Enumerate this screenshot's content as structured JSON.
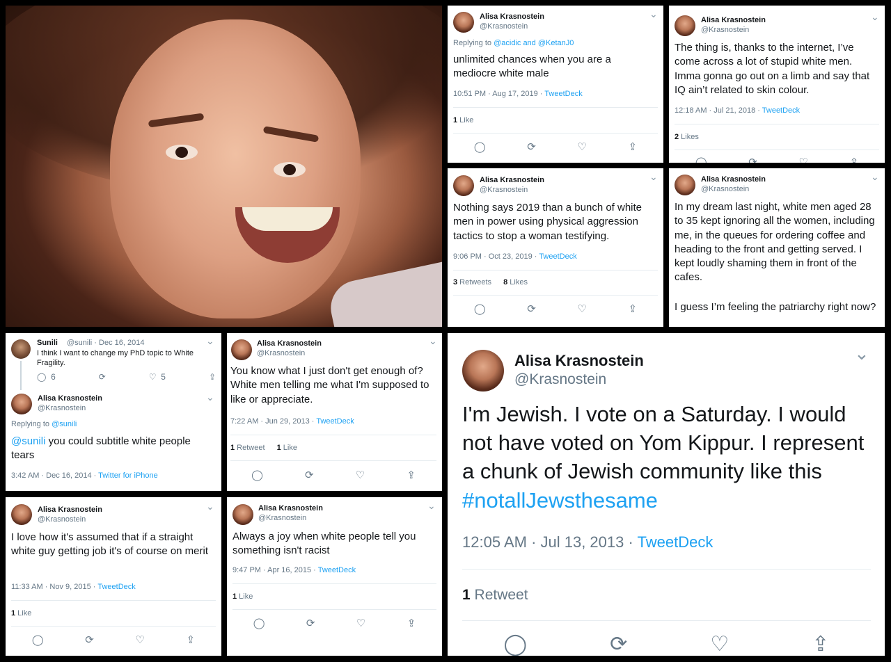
{
  "author": {
    "name": "Alisa Krasnostein",
    "handle": "@Krasnostein"
  },
  "icons": {
    "reply": "reply-icon",
    "retweet": "retweet-icon",
    "like": "heart-icon",
    "share": "share-icon",
    "caret": "chevron-down-icon"
  },
  "glyphs": {
    "reply": "◯",
    "retweet": "⟳",
    "like": "♡",
    "share": "⇪",
    "caret": "⌄"
  },
  "colors": {
    "link": "#1da1f2",
    "muted": "#657786",
    "text": "#14171a"
  },
  "t1": {
    "replying_prefix": "Replying to ",
    "replying_to": "@acidic and @KetanJ0",
    "text": "unlimited chances when you are a mediocre white male",
    "time": "10:51 PM · Aug 17, 2019 · ",
    "source": "TweetDeck",
    "likes": "1",
    "likes_label": " Like"
  },
  "t2": {
    "text": "The thing is, thanks to the internet, I’ve come across a lot of stupid white men. Imma gonna go out on a limb and say that IQ ain’t related to skin colour.",
    "time": "12:18 AM · Jul 21, 2018 · ",
    "source": "TweetDeck",
    "likes": "2",
    "likes_label": " Likes"
  },
  "t3": {
    "text": "Nothing says 2019 than a bunch of white men in power using physical aggression tactics to stop a woman testifying.",
    "time": "9:06 PM · Oct 23, 2019 · ",
    "source": "TweetDeck",
    "retweets": "3",
    "retweets_label": " Retweets",
    "likes": "8",
    "likes_label": " Likes"
  },
  "t4": {
    "text": "In my dream last night, white men aged 28 to 35 kept ignoring all the women, including me, in the queues for ordering coffee and heading to the front and getting served. I kept loudly  shaming them in front of the cafes.",
    "text2": "I guess I’m feeling the patriarchy right now?"
  },
  "t5": {
    "parent_name": "Sunili",
    "parent_handle": "@sunili · Dec 16, 2014",
    "parent_text": "I think I want to change my PhD topic to White Fragility.",
    "parent_replies": "6",
    "parent_likes": "5",
    "replying_prefix": "Replying to ",
    "replying_to": "@sunili",
    "mention": "@sunili",
    "text": " you could subtitle white people tears",
    "time": "3:42 AM · Dec 16, 2014 · ",
    "source": "Twitter for iPhone"
  },
  "t6": {
    "text": "You know what I just don't get enough of? White men telling me what I'm supposed to like or appreciate.",
    "time": "7:22 AM · Jun 29, 2013 · ",
    "source": "TweetDeck",
    "retweets": "1",
    "retweets_label": " Retweet",
    "likes": "1",
    "likes_label": " Like"
  },
  "t7": {
    "text": "I love how it's assumed that if a straight white guy getting job it's of course on merit",
    "time": "11:33 AM · Nov 9, 2015 · ",
    "source": "TweetDeck",
    "likes": "1",
    "likes_label": " Like"
  },
  "t8": {
    "text": "Always a joy when white people tell you something isn't racist",
    "time": "9:47 PM · Apr 16, 2015 · ",
    "source": "TweetDeck",
    "likes": "1",
    "likes_label": " Like"
  },
  "t9": {
    "text": "I'm Jewish. I vote on a Saturday. I would not have voted on Yom Kippur. I represent a chunk of Jewish community like this ",
    "hashtag": "#notallJewsthesame",
    "time": "12:05 AM · Jul 13, 2013 · ",
    "source": "TweetDeck",
    "retweets": "1",
    "retweets_label": " Retweet"
  }
}
